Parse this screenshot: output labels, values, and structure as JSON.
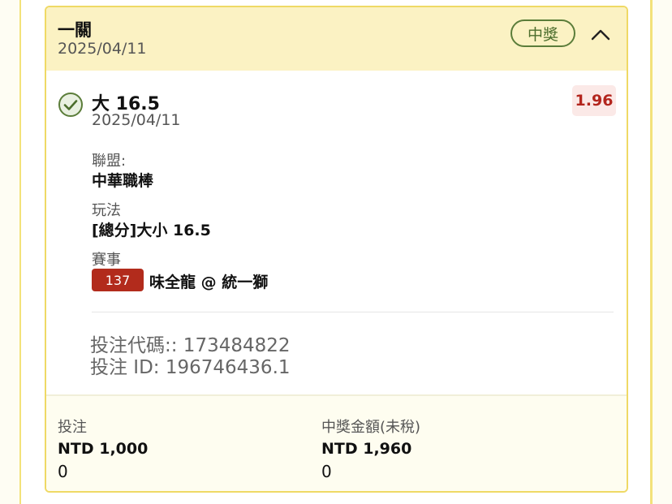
{
  "card": {
    "title": "一關",
    "date": "2025/04/11",
    "status_badge": "中獎",
    "collapse_icon": "chevron-up-icon"
  },
  "selection": {
    "status_icon": "check-circle-icon",
    "title": "大 16.5",
    "date": "2025/04/11",
    "odds": "1.96",
    "league_label": "聯盟:",
    "league_value": "中華職棒",
    "play_label": "玩法",
    "play_value": "[總分]大小 16.5",
    "event_label": "賽事",
    "event_number": "137",
    "event_name": "味全龍 @ 統一獅",
    "bet_code": "投注代碼:: 173484822",
    "bet_id": "投注 ID: 196746436.1"
  },
  "footer": {
    "stake_label": "投注",
    "stake_value": "NTD 1,000",
    "stake_sub": "0",
    "payout_label": "中獎金額(未稅)",
    "payout_value": "NTD 1,960",
    "payout_sub": "0"
  },
  "colors": {
    "header_bg": "#fbf2c3",
    "border": "#efd965",
    "win_green": "#4b6d2c",
    "odds_red": "#b3261e",
    "event_badge": "#b22b1c"
  }
}
